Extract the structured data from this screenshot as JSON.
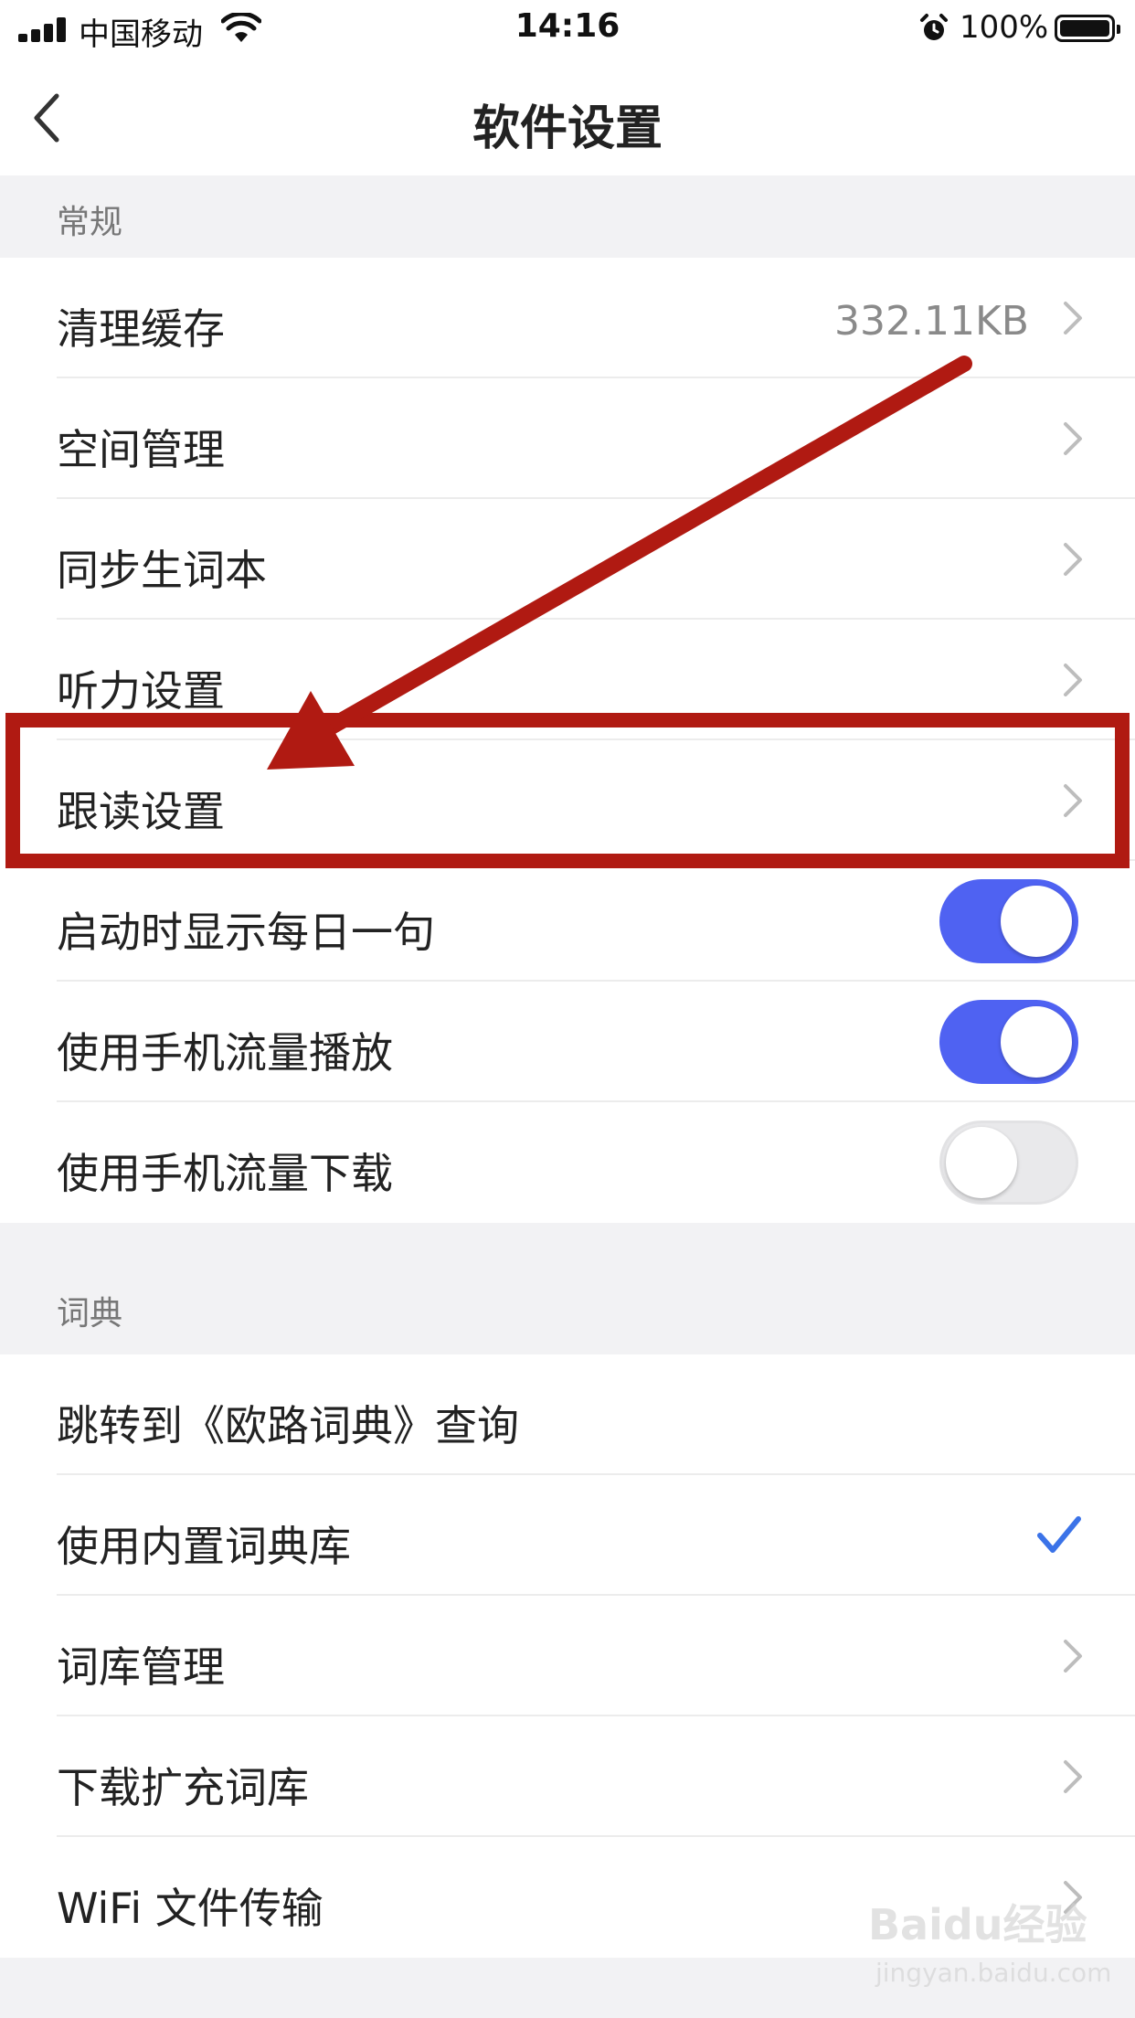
{
  "status_bar": {
    "carrier": "中国移动",
    "time": "14:16",
    "battery": "100%"
  },
  "nav": {
    "title": "软件设置",
    "back_icon": "chevron-left-icon"
  },
  "sections": {
    "general": {
      "header": "常规",
      "rows": [
        {
          "label": "清理缓存",
          "value": "332.11KB",
          "accessory": "chevron"
        },
        {
          "label": "空间管理",
          "accessory": "chevron"
        },
        {
          "label": "同步生词本",
          "accessory": "chevron"
        },
        {
          "label": "听力设置",
          "accessory": "chevron"
        },
        {
          "label": "跟读设置",
          "accessory": "chevron"
        },
        {
          "label": "启动时显示每日一句",
          "accessory": "toggle",
          "on": true
        },
        {
          "label": "使用手机流量播放",
          "accessory": "toggle",
          "on": true
        },
        {
          "label": "使用手机流量下载",
          "accessory": "toggle",
          "on": false
        }
      ]
    },
    "dictionary": {
      "header": "词典",
      "rows": [
        {
          "label": "跳转到《欧路词典》查询",
          "accessory": "none"
        },
        {
          "label": "使用内置词典库",
          "accessory": "check"
        },
        {
          "label": "词库管理",
          "accessory": "chevron"
        },
        {
          "label": "下载扩充词库",
          "accessory": "chevron"
        },
        {
          "label": "WiFi 文件传输",
          "accessory": "chevron"
        }
      ]
    }
  },
  "colors": {
    "toggle_on": "#4f62f2",
    "check": "#3b73e8",
    "annotation": "#b01a12"
  },
  "watermark": {
    "text": "Baidu经验",
    "sub": "jingyan.baidu.com"
  }
}
